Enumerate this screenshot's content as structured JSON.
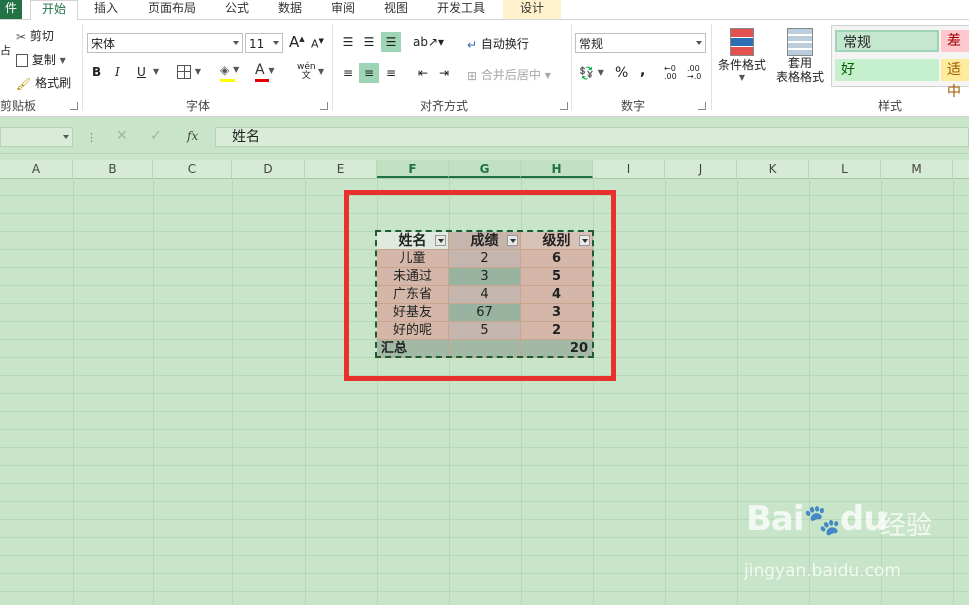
{
  "tabs": [
    {
      "label": "件"
    },
    {
      "label": "开始"
    },
    {
      "label": "插入"
    },
    {
      "label": "页面布局"
    },
    {
      "label": "公式"
    },
    {
      "label": "数据"
    },
    {
      "label": "审阅"
    },
    {
      "label": "视图"
    },
    {
      "label": "开发工具"
    },
    {
      "label": "设计"
    }
  ],
  "clipboard": {
    "cut": "剪切",
    "copy": "复制",
    "painter": "格式刷",
    "group": "剪贴板",
    "paste_partial": "占"
  },
  "font": {
    "name": "宋体",
    "size": "11",
    "grow": "A",
    "shrink": "A",
    "bold": "B",
    "italic": "I",
    "underline": "U",
    "group": "字体",
    "phonetic": "wén"
  },
  "alignment": {
    "wrap": "自动换行",
    "merge": "合并后居中",
    "group": "对齐方式"
  },
  "number": {
    "format": "常规",
    "percent": "%",
    "comma": ",",
    "group": "数字"
  },
  "styles": {
    "conditional": "条件格式",
    "table_format_line1": "套用",
    "table_format_line2": "表格格式",
    "cells": [
      "常规",
      "差",
      "好",
      "适中"
    ],
    "group": "样式"
  },
  "formula_bar": {
    "fx": "fx",
    "content": "姓名"
  },
  "columns": [
    "A",
    "B",
    "C",
    "D",
    "E",
    "F",
    "G",
    "H",
    "I",
    "J",
    "K",
    "L",
    "M"
  ],
  "table": {
    "headers": [
      "姓名",
      "成绩",
      "级别"
    ],
    "rows": [
      [
        "儿童",
        "2",
        "6"
      ],
      [
        "未通过",
        "3",
        "5"
      ],
      [
        "广东省",
        "4",
        "4"
      ],
      [
        "好基友",
        "67",
        "3"
      ],
      [
        "好的呢",
        "5",
        "2"
      ]
    ],
    "total_label": "汇总",
    "total_value": "20"
  },
  "watermark": {
    "brand": "Bai",
    "brand2": "du",
    "cn": "经验",
    "url": "jingyan.baidu.com"
  },
  "colors": {
    "accent": "#217346",
    "highlight": "#e8302c"
  }
}
